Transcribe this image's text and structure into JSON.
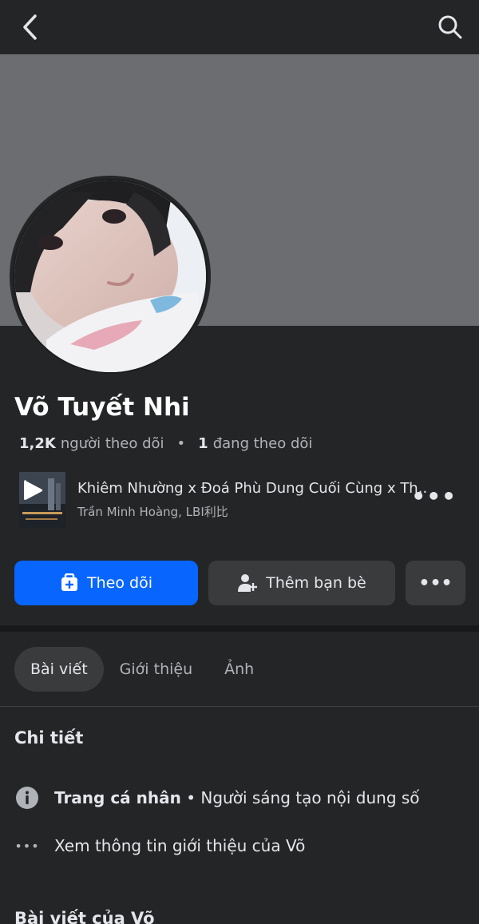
{
  "header": {
    "back_icon": "chevron-left-icon",
    "search_icon": "search-icon"
  },
  "profile": {
    "name": "Võ Tuyết Nhi",
    "followers_count": "1,2K",
    "followers_label": "người theo dõi",
    "separator": "•",
    "following_count": "1",
    "following_label": "đang theo dõi"
  },
  "music": {
    "title": "Khiêm Nhường x Đoá Phù Dung Cuối Cùng x Th...",
    "artist": "Trần Minh Hoàng, LBI利比",
    "more": "•••"
  },
  "actions": {
    "follow_label": "Theo dõi",
    "add_friend_label": "Thêm bạn bè",
    "more_label": "•••"
  },
  "tabs": [
    {
      "label": "Bài viết"
    },
    {
      "label": "Giới thiệu"
    },
    {
      "label": "Ảnh"
    }
  ],
  "details": {
    "title": "Chi tiết",
    "page_type_strong": "Trang cá nhân",
    "page_type_rest": " • Người sáng tạo nội dung số",
    "see_more": "Xem thông tin giới thiệu của Võ",
    "more_icon": "•••"
  },
  "posts": {
    "title": "Bài viết của Võ"
  },
  "colors": {
    "accent": "#0866ff",
    "background": "#242526",
    "cover": "#6b6d70",
    "button_secondary": "#3a3b3c"
  }
}
